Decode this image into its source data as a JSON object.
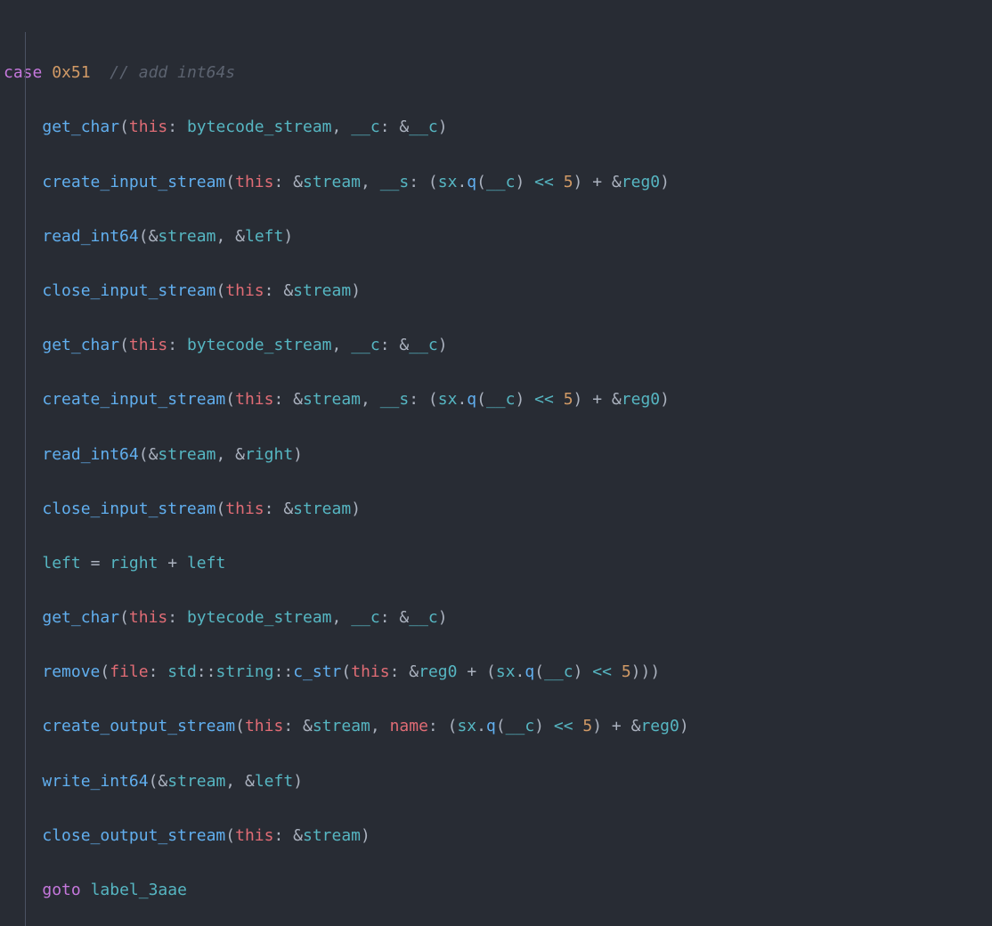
{
  "chart_data": null,
  "code": {
    "case_kw": "case",
    "case_val": "0x51",
    "comment": "// add int64s",
    "goto_kw": "goto",
    "goto_label": "label_3aae",
    "fn": {
      "get_char": "get_char",
      "create_input_stream": "create_input_stream",
      "read_int64": "read_int64",
      "close_input_stream": "close_input_stream",
      "remove": "remove",
      "create_output_stream": "create_output_stream",
      "write_int64": "write_int64",
      "close_output_stream": "close_output_stream",
      "c_str": "c_str"
    },
    "param": {
      "this": "this",
      "file": "file",
      "name": "name",
      "c": "__c",
      "s": "__s"
    },
    "id": {
      "bytecode_stream": "bytecode_stream",
      "stream": "stream",
      "left": "left",
      "right": "right",
      "reg0": "reg0",
      "sx": "sx",
      "q": "q",
      "std": "std",
      "string": "string"
    },
    "num": {
      "five": "5"
    },
    "op": {
      "amp": "&",
      "shl": "<<",
      "plus": "+",
      "eq": "=",
      "scope": "::",
      "dot": "."
    }
  }
}
